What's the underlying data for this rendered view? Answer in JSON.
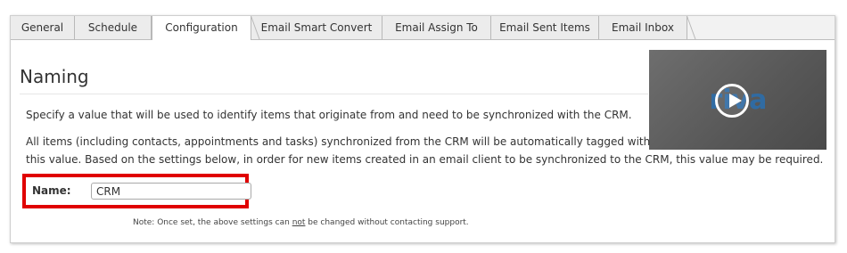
{
  "tabs": [
    {
      "label": "General",
      "active": false
    },
    {
      "label": "Schedule",
      "active": false
    },
    {
      "label": "Configuration",
      "active": true
    },
    {
      "label": "Email Smart Convert",
      "active": false
    },
    {
      "label": "Email Assign To",
      "active": false
    },
    {
      "label": "Email Sent Items",
      "active": false
    },
    {
      "label": "Email Inbox",
      "active": false
    }
  ],
  "section": {
    "title": "Naming",
    "paragraph1": "Specify a value that will be used to identify items that originate from and need to be synchronized with the CRM.",
    "paragraph2_line1": "All items (including contacts, appointments and tasks) synchronized from the CRM will be automatically tagged with",
    "paragraph2_line2": "this value. Based on the settings below, in order for new items created in an email client to be synchronized to the CRM, this value may be required."
  },
  "name_field": {
    "label": "Name:",
    "value": "CRM"
  },
  "note": {
    "before": "Note: Once set, the above settings can ",
    "emphasis": "not",
    "after": " be changed without contacting support."
  },
  "video": {
    "logo_text": "riva",
    "icon": "play-icon"
  },
  "colors": {
    "highlight_border": "#e00000",
    "tab_active_bg": "#ffffff",
    "tab_inactive_bg": "#ececec",
    "logo_blue": "#2a6fb0"
  }
}
